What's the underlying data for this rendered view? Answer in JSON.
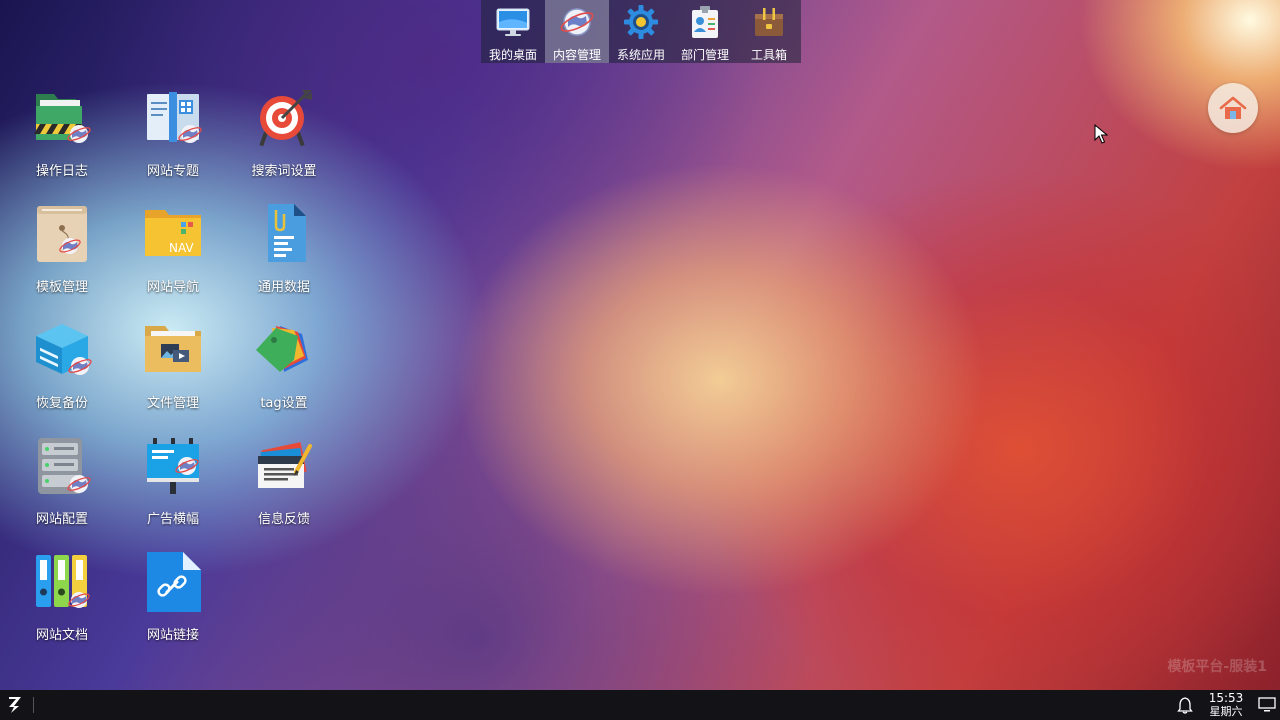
{
  "topbar": {
    "tabs": [
      {
        "label": "我的桌面",
        "icon": "monitor-icon"
      },
      {
        "label": "内容管理",
        "icon": "globe-icon",
        "active": true
      },
      {
        "label": "系统应用",
        "icon": "gear-icon"
      },
      {
        "label": "部门管理",
        "icon": "id-badge-icon"
      },
      {
        "label": "工具箱",
        "icon": "toolbox-icon"
      }
    ]
  },
  "desktop": {
    "icons": [
      {
        "label": "操作日志",
        "icon": "folder-log-icon"
      },
      {
        "label": "网站专题",
        "icon": "document-topic-icon"
      },
      {
        "label": "搜索词设置",
        "icon": "target-icon"
      },
      {
        "label": "模板管理",
        "icon": "template-envelope-icon"
      },
      {
        "label": "网站导航",
        "icon": "nav-folder-icon"
      },
      {
        "label": "通用数据",
        "icon": "clip-document-icon"
      },
      {
        "label": "恢复备份",
        "icon": "server-box-icon"
      },
      {
        "label": "文件管理",
        "icon": "media-folder-icon"
      },
      {
        "label": "tag设置",
        "icon": "tag-icon"
      },
      {
        "label": "网站配置",
        "icon": "server-rack-icon"
      },
      {
        "label": "广告横幅",
        "icon": "billboard-icon"
      },
      {
        "label": "信息反馈",
        "icon": "feedback-icon"
      },
      {
        "label": "网站文档",
        "icon": "binders-icon"
      },
      {
        "label": "网站链接",
        "icon": "link-file-icon"
      }
    ]
  },
  "watermark": "模板平台-服装1",
  "taskbar": {
    "time": "15:53",
    "weekday": "星期六"
  },
  "colors": {
    "taskbar": "#121217",
    "active_tab": "#8f8fa8",
    "home_icon": "#e86a4a"
  }
}
